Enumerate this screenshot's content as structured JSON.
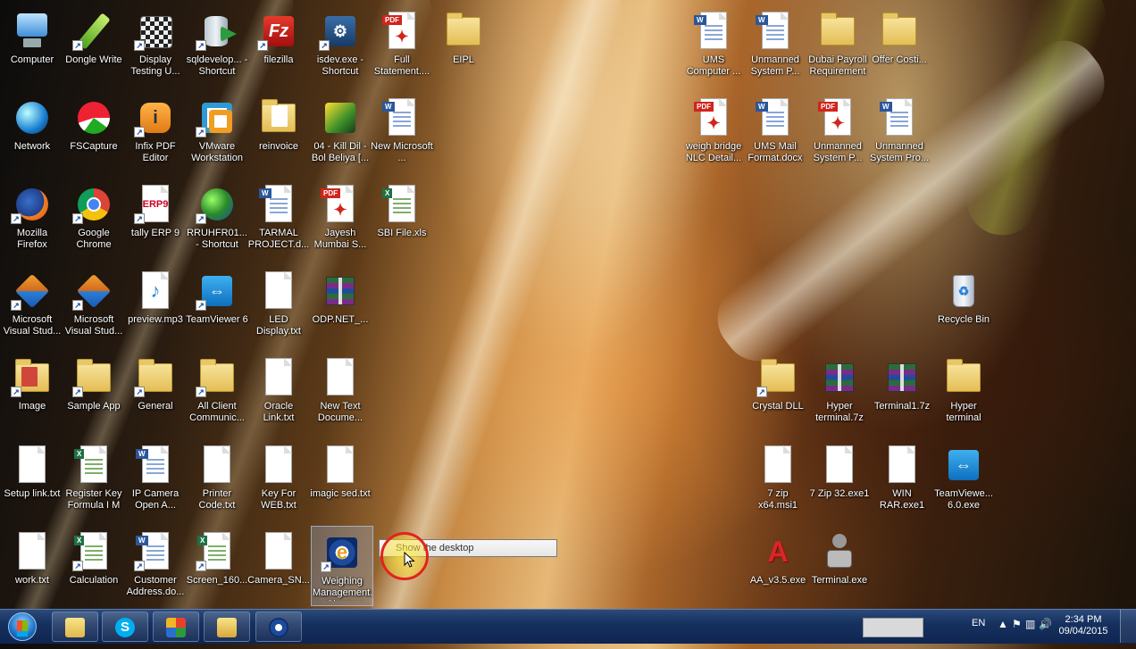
{
  "desktop": {
    "icons": [
      {
        "label": "Computer"
      },
      {
        "label": "Dongle Write"
      },
      {
        "label": "Display Testing U..."
      },
      {
        "label": "sqldevelop... - Shortcut"
      },
      {
        "label": "filezilla"
      },
      {
        "label": "isdev.exe - Shortcut"
      },
      {
        "label": "Full Statement...."
      },
      {
        "label": "EIPL"
      },
      {
        "label": "Network"
      },
      {
        "label": "FSCapture"
      },
      {
        "label": "Infix PDF Editor"
      },
      {
        "label": "VMware Workstation"
      },
      {
        "label": "reinvoice"
      },
      {
        "label": "04 - Kill Dil - Bol Beliya [..."
      },
      {
        "label": "New Microsoft ..."
      },
      {
        "label": "Mozilla Firefox"
      },
      {
        "label": "Google Chrome"
      },
      {
        "label": "tally ERP 9"
      },
      {
        "label": "RRUHFR01... - Shortcut"
      },
      {
        "label": "TARMAL PROJECT.d..."
      },
      {
        "label": "Jayesh Mumbai S..."
      },
      {
        "label": "SBI File.xls"
      },
      {
        "label": "Microsoft Visual Stud..."
      },
      {
        "label": "Microsoft Visual Stud..."
      },
      {
        "label": "preview.mp3"
      },
      {
        "label": "TeamViewer 6"
      },
      {
        "label": "LED Display.txt"
      },
      {
        "label": "ODP.NET_..."
      },
      {
        "label": "Image"
      },
      {
        "label": "Sample App"
      },
      {
        "label": "General"
      },
      {
        "label": "All Client Communic..."
      },
      {
        "label": "Oracle Link.txt"
      },
      {
        "label": "New Text Docume..."
      },
      {
        "label": "Setup link.txt"
      },
      {
        "label": "Register Key Formula I M"
      },
      {
        "label": "IP Camera Open A..."
      },
      {
        "label": "Printer Code.txt"
      },
      {
        "label": "Key For WEB.txt"
      },
      {
        "label": "imagic sed.txt"
      },
      {
        "label": "work.txt"
      },
      {
        "label": "Calculation"
      },
      {
        "label": "Customer Address.do..."
      },
      {
        "label": "Screen_160..."
      },
      {
        "label": "Camera_SN..."
      },
      {
        "label": "Weighing Management.exe - Shortcut"
      },
      {
        "label": "UMS Computer ..."
      },
      {
        "label": "Unmanned System P..."
      },
      {
        "label": "Dubai Payroll Requirement"
      },
      {
        "label": "Offer Costi..."
      },
      {
        "label": "weigh bridge NLC Detail..."
      },
      {
        "label": "UMS Mail Format.docx"
      },
      {
        "label": "Unmanned System P..."
      },
      {
        "label": "Unmanned System Pro..."
      },
      {
        "label": "Recycle Bin"
      },
      {
        "label": "Crystal DLL"
      },
      {
        "label": "Hyper terminal.7z"
      },
      {
        "label": "Terminal1.7z"
      },
      {
        "label": "Hyper terminal"
      },
      {
        "label": "7 zip x64.msi1"
      },
      {
        "label": "7 Zip 32.exe1"
      },
      {
        "label": "WIN RAR.exe1"
      },
      {
        "label": "TeamViewe... 6.0.exe"
      },
      {
        "label": "AA_v3.5.exe"
      },
      {
        "label": "Terminal.exe"
      }
    ]
  },
  "tooltip": {
    "text": "Show the desktop"
  },
  "taskbar": {
    "buttons": [
      {
        "icon": "start-orb-icon"
      },
      {
        "icon": "folder-note-icon"
      },
      {
        "icon": "skype-icon",
        "glyph": "S"
      },
      {
        "icon": "app-grid-icon"
      },
      {
        "icon": "file-explorer-icon"
      },
      {
        "icon": "weighing-management-icon"
      }
    ],
    "language": "EN",
    "time": "2:34 PM",
    "date": "09/04/2015"
  },
  "colors": {
    "taskbar": "#16315f",
    "tooltip_highlight": "#e2231a"
  }
}
